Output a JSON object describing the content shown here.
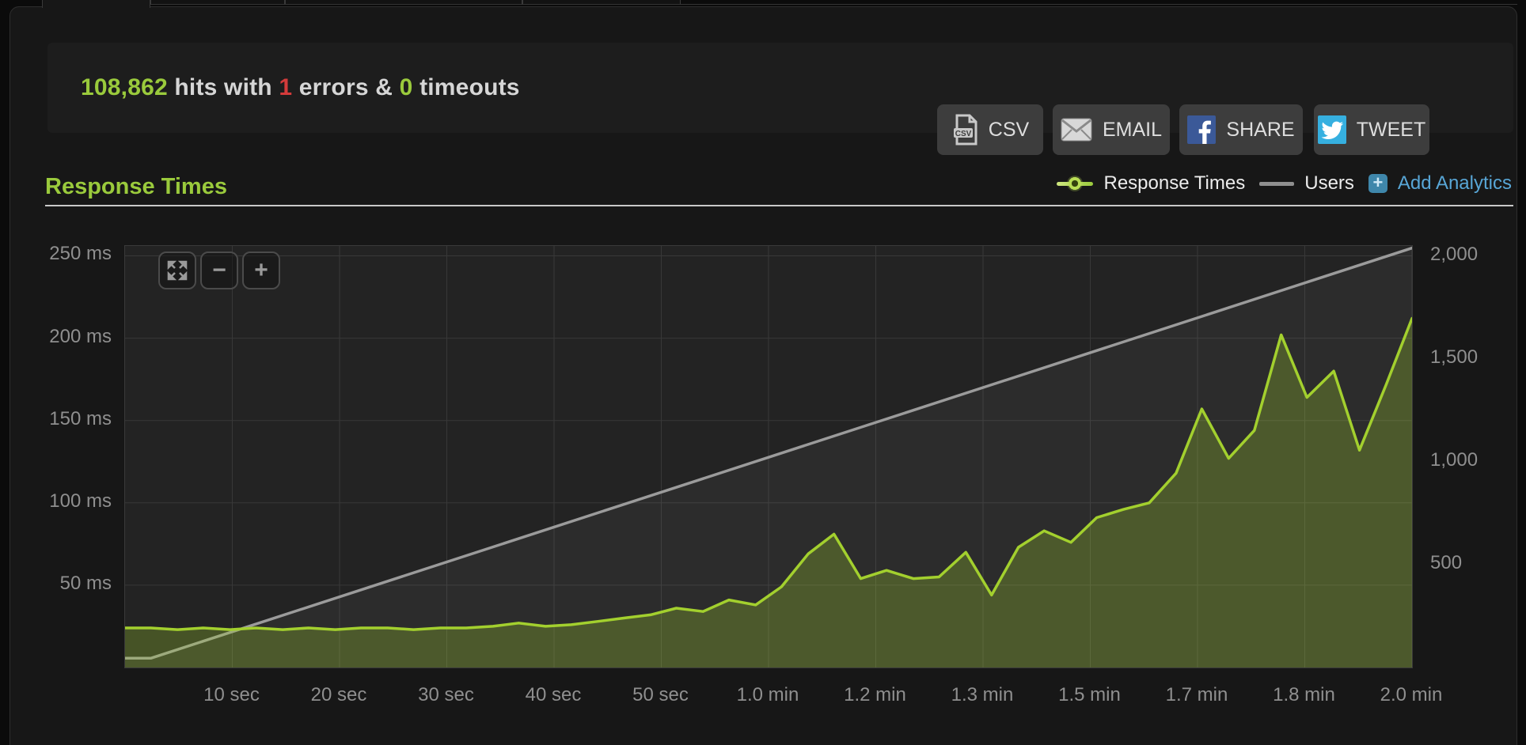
{
  "page": {
    "bg": "#0b0b0b",
    "panel_bg": "#171717",
    "accent_green": "#9aca3c",
    "accent_red": "#d43b3b",
    "accent_blue": "#58a6d6"
  },
  "summary": {
    "hits": "108,862",
    "hits_suffix": " hits with ",
    "errors": "1",
    "errors_suffix": " errors & ",
    "timeouts": "0",
    "timeouts_suffix": " timeouts"
  },
  "toolbar": {
    "buttons": [
      {
        "label": "CSV",
        "icon": "csv-file-icon"
      },
      {
        "label": "EMAIL",
        "icon": "envelope-icon"
      },
      {
        "label": "SHARE",
        "icon": "facebook-icon",
        "icon_color": "#3b5998"
      },
      {
        "label": "TWEET",
        "icon": "twitter-icon",
        "icon_color": "#36b0e0"
      }
    ]
  },
  "section": {
    "title": "Response Times"
  },
  "legend": {
    "items": [
      {
        "label": "Response Times",
        "marker": "line-with-point",
        "color": "#9aca3c"
      },
      {
        "label": "Users",
        "marker": "line",
        "color": "#8f8f8f"
      },
      {
        "label": "Add Analytics",
        "marker": "plus-icon",
        "color": "#58a6d6"
      }
    ]
  },
  "zoom_controls": {
    "expand": "expand-arrows-icon",
    "zoom_out": "−",
    "zoom_in": "+"
  },
  "chart_data": {
    "type": "area",
    "title": "Response Times",
    "x_unit": "seconds",
    "x_range": [
      0,
      120
    ],
    "x_ticks": {
      "seconds": [
        10,
        20,
        30,
        40,
        50,
        60,
        70,
        80,
        90,
        100,
        110,
        120
      ],
      "labels": [
        "10 sec",
        "20 sec",
        "30 sec",
        "40 sec",
        "50 sec",
        "1.0 min",
        "1.2 min",
        "1.3 min",
        "1.5 min",
        "1.7 min",
        "1.8 min",
        "2.0 min"
      ]
    },
    "y_left": {
      "title": "response time ms",
      "range": [
        0,
        256
      ],
      "ticks": [
        50,
        100,
        150,
        200,
        250
      ],
      "labels": [
        "50 ms",
        "100 ms",
        "150 ms",
        "200 ms",
        "250 ms"
      ]
    },
    "y_right": {
      "title": "users",
      "range": [
        0,
        2050
      ],
      "ticks": [
        500,
        1000,
        1500,
        2000
      ],
      "labels": [
        "500",
        "1,000",
        "1,500",
        "2,000"
      ]
    },
    "grid": true,
    "legend_position": "top-right",
    "series": [
      {
        "name": "Users",
        "axis": "right",
        "color": "#9b9b9b",
        "fill": "rgba(255,255,255,0.045)",
        "x": [
          0,
          2.4,
          120
        ],
        "values": [
          45,
          45,
          2040
        ]
      },
      {
        "name": "Response Times",
        "axis": "left",
        "color": "#a3d02e",
        "fill": "rgba(163,208,46,0.28)",
        "x": [
          0,
          2.4,
          4.9,
          7.3,
          9.8,
          12.2,
          14.7,
          17.1,
          19.6,
          22,
          24.5,
          26.9,
          29.4,
          31.8,
          34.3,
          36.7,
          39.2,
          41.6,
          44.1,
          46.5,
          49,
          51.4,
          53.9,
          56.3,
          58.8,
          61.2,
          63.7,
          66.1,
          68.6,
          71,
          73.5,
          75.9,
          78.4,
          80.8,
          83.3,
          85.7,
          88.2,
          90.6,
          93.1,
          95.5,
          98,
          100.4,
          102.9,
          105.3,
          107.8,
          110.2,
          112.7,
          115.1,
          117.6,
          120
        ],
        "values": [
          24,
          24,
          23,
          24,
          23,
          24,
          23,
          24,
          23,
          24,
          24,
          23,
          24,
          24,
          25,
          27,
          25,
          26,
          28,
          30,
          32,
          36,
          34,
          41,
          38,
          49,
          69,
          81,
          54,
          59,
          54,
          55,
          70,
          44,
          73,
          83,
          76,
          91,
          96,
          100,
          118,
          157,
          127,
          144,
          202,
          164,
          180,
          132,
          172,
          212
        ]
      }
    ]
  }
}
